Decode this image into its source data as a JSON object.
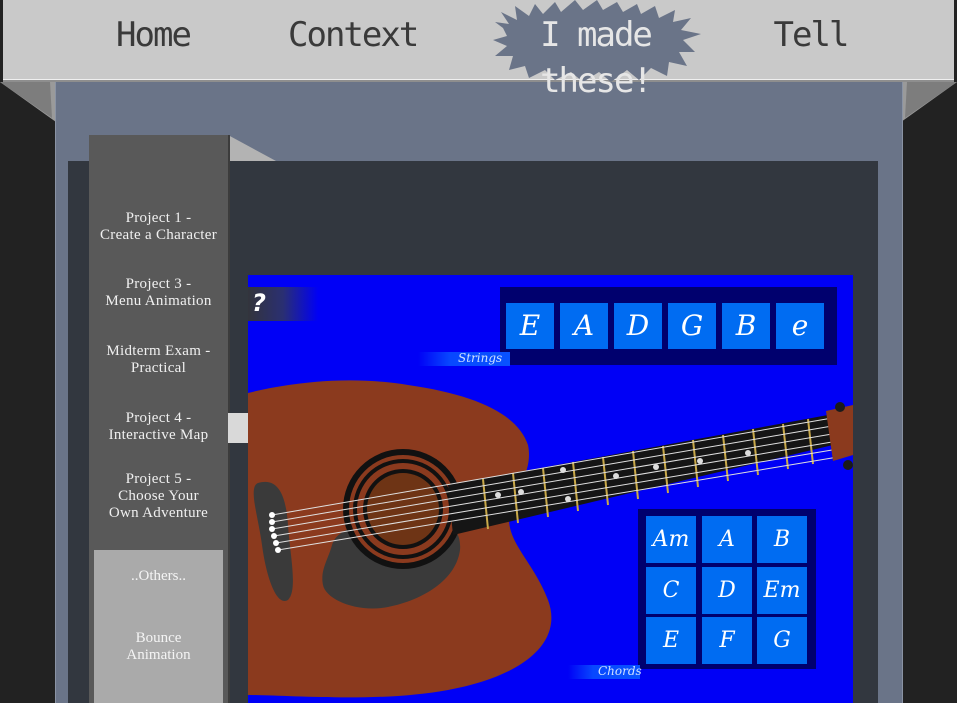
{
  "nav": {
    "items": [
      "Home",
      "Context",
      "I made these!",
      "Tell"
    ],
    "active_index": 2
  },
  "sidebar": {
    "items": [
      {
        "line1": "Project 1 -",
        "line2": "Create a Character"
      },
      {
        "line1": "Project 3 -",
        "line2": "Menu Animation"
      },
      {
        "line1": "Midterm Exam -",
        "line2": "Practical"
      },
      {
        "line1": "Project 4 -",
        "line2": "Interactive Map"
      },
      {
        "line1": "Project 5 -",
        "line2": "Choose Your",
        "line3": "Own Adventure"
      }
    ],
    "others_label": "..Others..",
    "bounce": {
      "line1": "Bounce",
      "line2": "Animation"
    }
  },
  "flash": {
    "help_label": "?",
    "strings_label": "Strings",
    "strings": [
      "E",
      "A",
      "D",
      "G",
      "B",
      "e"
    ],
    "chords_label": "Chords",
    "chords": [
      "Am",
      "A",
      "B",
      "C",
      "D",
      "Em",
      "E",
      "F",
      "G"
    ]
  },
  "colors": {
    "flash_bg": "#0000f6",
    "key_bg": "#006cf2",
    "panel_bg": "#00006e",
    "guitar_body": "#8b3a1e"
  }
}
